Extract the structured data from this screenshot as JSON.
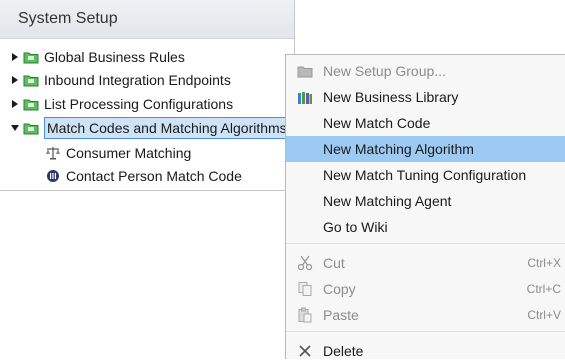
{
  "panel": {
    "title": "System Setup",
    "tree": [
      {
        "label": "Global Business Rules",
        "state": "collapsed",
        "icon": "folder-icon"
      },
      {
        "label": "Inbound Integration Endpoints",
        "state": "collapsed",
        "icon": "folder-icon"
      },
      {
        "label": "List Processing Configurations",
        "state": "collapsed",
        "icon": "folder-icon"
      },
      {
        "label": "Match Codes and Matching Algorithms",
        "state": "expanded",
        "icon": "folder-icon",
        "selected": true
      },
      {
        "label": "Consumer Matching",
        "icon": "scale-icon",
        "child": true
      },
      {
        "label": "Contact Person Match Code",
        "icon": "match-code-icon",
        "child": true
      }
    ]
  },
  "menu": {
    "items": [
      {
        "label": "New Setup Group...",
        "icon": "setup-group-icon",
        "disabled": true,
        "shortcut": ""
      },
      {
        "label": "New Business Library",
        "icon": "business-library-icon",
        "disabled": false,
        "shortcut": ""
      },
      {
        "label": "New Match Code",
        "icon": "",
        "disabled": false,
        "shortcut": ""
      },
      {
        "label": "New Matching Algorithm",
        "icon": "",
        "disabled": false,
        "highlight": true,
        "shortcut": ""
      },
      {
        "label": "New Match Tuning Configuration",
        "icon": "",
        "disabled": false,
        "shortcut": ""
      },
      {
        "label": "New Matching Agent",
        "icon": "",
        "disabled": false,
        "shortcut": ""
      },
      {
        "label": "Go to Wiki",
        "icon": "",
        "disabled": false,
        "shortcut": ""
      },
      {
        "label": "Cut",
        "icon": "scissors-icon",
        "disabled": true,
        "shortcut": "Ctrl+X"
      },
      {
        "label": "Copy",
        "icon": "copy-icon",
        "disabled": true,
        "shortcut": "Ctrl+C"
      },
      {
        "label": "Paste",
        "icon": "paste-icon",
        "disabled": true,
        "shortcut": "Ctrl+V"
      },
      {
        "label": "Delete",
        "icon": "delete-icon",
        "disabled": false,
        "shortcut": ""
      }
    ]
  },
  "colors": {
    "highlight": "#9ccaf2",
    "selected_bg": "#cfe3f7",
    "folder_green": "#4caf50"
  }
}
